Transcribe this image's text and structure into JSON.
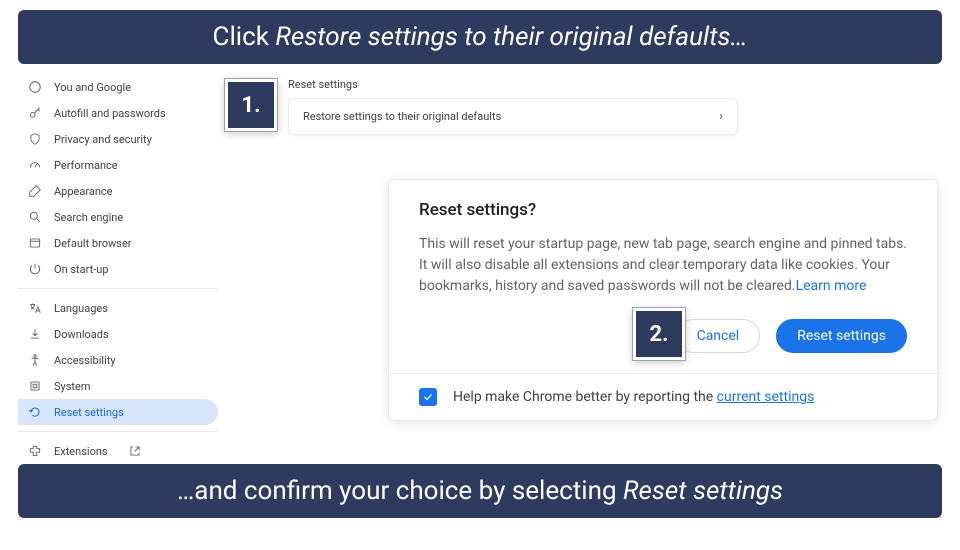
{
  "banners": {
    "top_prefix": "Click ",
    "top_italic": "Restore settings to their original defaults…",
    "bottom_prefix": "…and confirm your choice by selecting ",
    "bottom_italic": "Reset settings"
  },
  "steps": {
    "one": "1.",
    "two": "2."
  },
  "sidebar": {
    "items": [
      {
        "label": "You and Google"
      },
      {
        "label": "Autofill and passwords"
      },
      {
        "label": "Privacy and security"
      },
      {
        "label": "Performance"
      },
      {
        "label": "Appearance"
      },
      {
        "label": "Search engine"
      },
      {
        "label": "Default browser"
      },
      {
        "label": "On start-up"
      }
    ],
    "advanced": [
      {
        "label": "Languages"
      },
      {
        "label": "Downloads"
      },
      {
        "label": "Accessibility"
      },
      {
        "label": "System"
      },
      {
        "label": "Reset settings"
      }
    ],
    "extensions_label": "Extensions"
  },
  "section": {
    "title": "Reset settings",
    "restore_label": "Restore settings to their original defaults"
  },
  "dialog": {
    "title": "Reset settings?",
    "body": "This will reset your startup page, new tab page, search engine and pinned tabs. It will also disable all extensions and clear temporary data like cookies. Your bookmarks, history and saved passwords will not be cleared.",
    "learn_more": "Learn more",
    "cancel": "Cancel",
    "confirm": "Reset settings",
    "help_prefix": "Help make Chrome better by reporting the ",
    "help_link": "current settings",
    "checkbox_checked": true
  }
}
